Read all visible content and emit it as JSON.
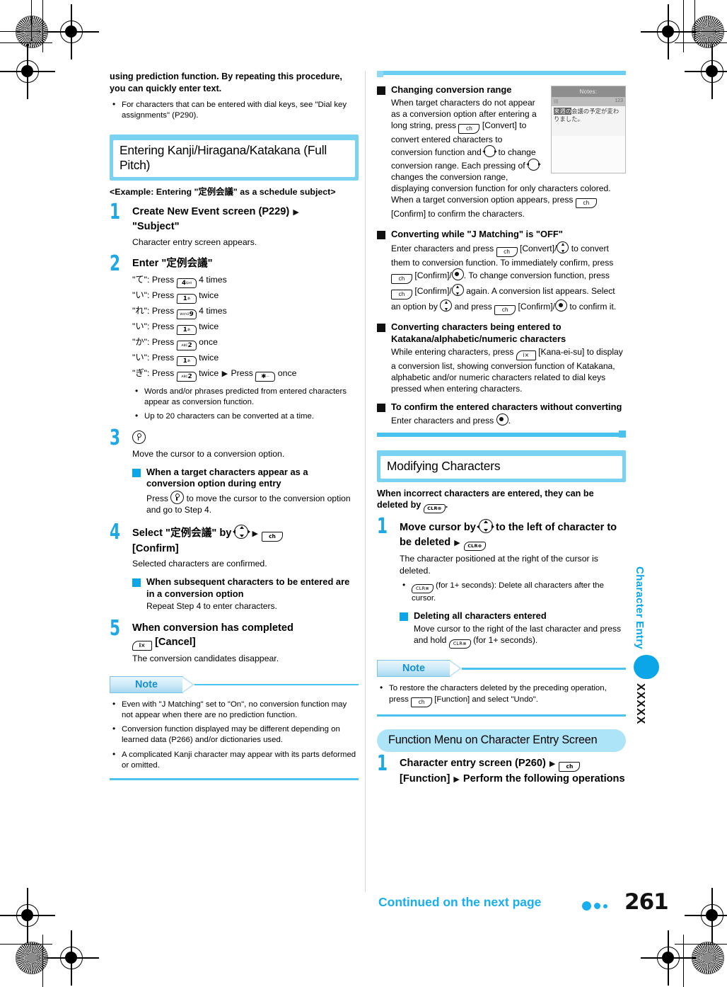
{
  "page": {
    "number": "261",
    "continued_label": "Continued on the next page",
    "margin_tab_title": "Character Entry",
    "margin_tab_code": "XXXXX"
  },
  "left": {
    "lead": "using prediction function. By repeating this procedure, you can quickly enter text.",
    "lead_bullets": [
      "For characters that can be entered with dial keys, see \"Dial key assignments\" (P290)."
    ],
    "section_title": "Entering Kanji/Hiragana/Katakana (Full Pitch)",
    "example_line": "<Example: Entering \"定例会議\" as a schedule subject>",
    "steps": [
      {
        "num": "1",
        "title_a": "Create New Event screen (P229)",
        "title_b": "\"Subject\"",
        "desc": "Character entry screen appears."
      },
      {
        "num": "2",
        "title": "Enter \"定例会議\"",
        "keys": [
          {
            "char": "\"て\": Press",
            "key": "4",
            "keysub": "GHI",
            "times": "4 times"
          },
          {
            "char": "\"い\": Press",
            "key": "1",
            "keysub": "あ",
            "times": "twice"
          },
          {
            "char": "\"れ\": Press",
            "key": "9",
            "keysub": "WXYZ",
            "times": "4 times"
          },
          {
            "char": "\"い\": Press",
            "key": "1",
            "keysub": "あ",
            "times": "twice"
          },
          {
            "char": "\"か\": Press",
            "key": "2",
            "keysub": "ABC",
            "times": "once"
          },
          {
            "char": "\"い\": Press",
            "key": "1",
            "keysub": "あ",
            "times": "twice"
          },
          {
            "char": "\"ぎ\": Press",
            "key": "2",
            "keysub": "ABC",
            "times": "twice",
            "then": "Press",
            "key2": "∗",
            "times2": "once"
          }
        ],
        "bullets": [
          "Words and/or phrases predicted from entered characters appear as conversion function.",
          "Up to 20 characters can be converted at a time."
        ]
      },
      {
        "num": "3",
        "desc": "Move the cursor to a conversion option.",
        "sub": {
          "heading": "When a target characters appear as a conversion option during entry",
          "text_a": "Press",
          "text_b": "to move the cursor to the conversion option and go to Step 4."
        }
      },
      {
        "num": "4",
        "title_a": "Select \"定例会議\" by",
        "title_b": "[Confirm]",
        "desc": "Selected characters are confirmed.",
        "sub": {
          "heading": "When subsequent characters to be entered are in a conversion option",
          "text": "Repeat Step 4 to enter characters."
        }
      },
      {
        "num": "5",
        "title_a": "When conversion has completed",
        "title_b": "[Cancel]",
        "desc": "The conversion candidates disappear."
      }
    ],
    "note": {
      "label": "Note",
      "items": [
        "Even with \"J Matching\" set to \"On\", no conversion function may not appear when there are no prediction function.",
        "Conversion function displayed may be different depending on learned data (P266) and/or dictionaries used.",
        "A complicated Kanji character may appear with its parts deformed or omitted."
      ]
    }
  },
  "right": {
    "blocks": [
      {
        "heading": "Changing conversion range",
        "text_1": "When target characters do not appear as a conversion option after entering a long string, press",
        "text_2": "[Convert] to convert entered characters to conversion function and",
        "text_3": "to change conversion range.",
        "text_4": "Each pressing of",
        "text_5": "changes the conversion range, displaying conversion function for only characters colored. When a target conversion option appears, press",
        "text_6": "[Confirm] to confirm the characters."
      },
      {
        "heading": "Converting while \"J Matching\" is \"OFF\"",
        "text_1": "Enter characters and press",
        "text_2": "[Convert]/",
        "text_3": "to convert them to conversion function. To immediately confirm, press",
        "text_4": "[Confirm]/",
        "text_5": "To change conversion function, press",
        "text_6": "[Confirm]/",
        "text_7": "again. A conversion list appears. Select an option by",
        "text_8": "and press",
        "text_9": "[Confirm]/",
        "text_10": "to confirm it."
      },
      {
        "heading": "Converting characters being entered to Katakana/alphabetic/numeric characters",
        "text_1": "While entering characters, press",
        "text_2": "[Kana-ei-su] to display a conversion list, showing conversion function of Katakana, alphabetic and/or numeric characters related to dial keys pressed when entering characters."
      },
      {
        "heading": "To confirm the entered characters without converting",
        "text_1": "Enter characters and press",
        "text_2": "."
      }
    ],
    "phone_screenshot": {
      "title": "Notes:",
      "status_right": "123",
      "highlight": "来週の",
      "line1_rest": "会議の予定が変わ",
      "line2": "りました。"
    },
    "section_title": "Modifying Characters",
    "intro_a": "When incorrect characters are entered, they can be deleted by",
    "intro_b": ".",
    "step": {
      "num": "1",
      "title_a": "Move cursor by",
      "title_b": "to the left of character to be deleted",
      "desc": "The character positioned at the right of the cursor is deleted.",
      "bullet_a": "(for 1+ seconds): Delete all characters after the cursor.",
      "sub": {
        "heading": "Deleting all characters entered",
        "text_a": "Move cursor to the right of the last character and press and hold",
        "text_b": "(for 1+ seconds)."
      }
    },
    "note": {
      "label": "Note",
      "item_a": "To restore the characters deleted by the preceding operation, press",
      "item_b": "[Function] and select \"Undo\"."
    },
    "menu_section_title": "Function Menu on Character Entry Screen",
    "menu_step": {
      "num": "1",
      "title_a": "Character entry screen (P260)",
      "title_b": "[Function]",
      "title_c": "Perform the following operations"
    }
  },
  "keys": {
    "soft_right_label": "ch",
    "soft_left_label": "i×",
    "clr_label": "CLR⊗"
  }
}
